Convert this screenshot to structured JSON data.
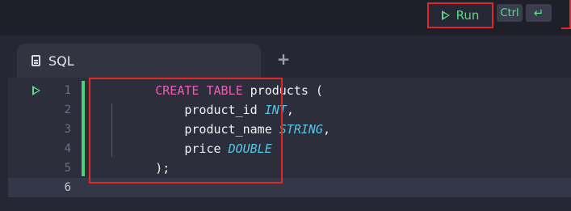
{
  "toolbar": {
    "run_label": "Run",
    "shortcut_ctrl": "Ctrl",
    "shortcut_enter": "↵"
  },
  "tabs": [
    {
      "label": "SQL",
      "icon": "document-icon"
    }
  ],
  "add_tab_label": "+",
  "editor": {
    "lines": [
      {
        "number": "1",
        "tokens": [
          [
            "kw",
            "CREATE TABLE"
          ],
          [
            "plain",
            " products ("
          ]
        ]
      },
      {
        "number": "2",
        "tokens": [
          [
            "plain",
            "    product_id "
          ],
          [
            "type",
            "INT"
          ],
          [
            "plain",
            ","
          ]
        ]
      },
      {
        "number": "3",
        "tokens": [
          [
            "plain",
            "    product_name "
          ],
          [
            "type",
            "STRING"
          ],
          [
            "plain",
            ","
          ]
        ]
      },
      {
        "number": "4",
        "tokens": [
          [
            "plain",
            "    price "
          ],
          [
            "type",
            "DOUBLE"
          ]
        ]
      },
      {
        "number": "5",
        "tokens": [
          [
            "plain",
            ");"
          ]
        ]
      },
      {
        "number": "6",
        "tokens": []
      }
    ],
    "current_line": "6"
  },
  "colors": {
    "accent_green": "#5ed98a",
    "keyword": "#ef5bb5",
    "type": "#53c7e8",
    "highlight_box": "#e02828"
  }
}
